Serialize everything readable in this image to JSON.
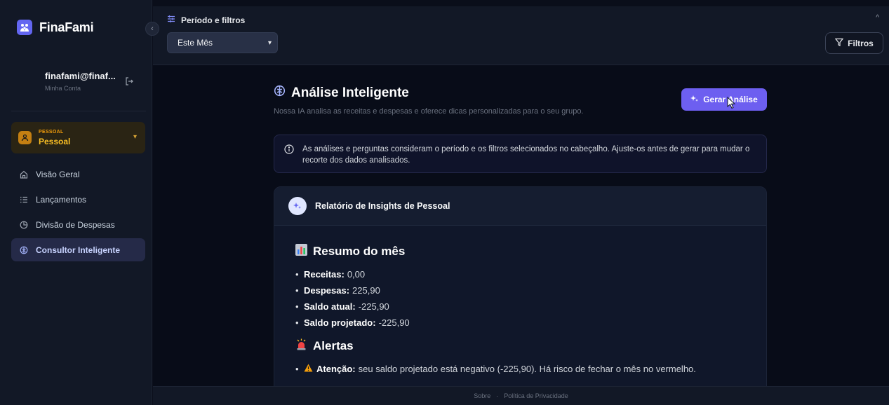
{
  "brand": {
    "name": "FinaFami"
  },
  "account": {
    "email": "finafami@finaf...",
    "label": "Minha Conta"
  },
  "group": {
    "kind": "PESSOAL",
    "name": "Pessoal"
  },
  "nav": [
    {
      "label": "Visão Geral",
      "icon": "home-icon"
    },
    {
      "label": "Lançamentos",
      "icon": "list-icon"
    },
    {
      "label": "Divisão de Despesas",
      "icon": "pie-chart-icon"
    },
    {
      "label": "Consultor Inteligente",
      "icon": "brain-icon",
      "active": true
    }
  ],
  "topbar": {
    "filters_title": "Período e filtros",
    "period_value": "Este Mês",
    "filters_button": "Filtros"
  },
  "page": {
    "title": "Análise Inteligente",
    "subtitle": "Nossa IA analisa as receitas e despesas e oferece dicas personalizadas para o seu grupo.",
    "generate_button": "Gerar Análise"
  },
  "info": {
    "text": "As análises e perguntas consideram o período e os filtros selecionados no cabeçalho. Ajuste-os antes de gerar para mudar o recorte dos dados analisados."
  },
  "report": {
    "title": "Relatório de Insights de Pessoal",
    "summary_title": "Resumo do mês",
    "summary": [
      {
        "label": "Receitas:",
        "value": "0,00"
      },
      {
        "label": "Despesas:",
        "value": "225,90"
      },
      {
        "label": "Saldo atual:",
        "value": "-225,90"
      },
      {
        "label": "Saldo projetado:",
        "value": "-225,90"
      }
    ],
    "alerts_title": "Alertas",
    "alerts": [
      {
        "label": "Atenção:",
        "value": "seu saldo projetado está negativo (-225,90). Há risco de fechar o mês no vermelho."
      }
    ]
  },
  "footer": {
    "about": "Sobre",
    "separator": "·",
    "privacy": "Política de Privacidade"
  },
  "colors": {
    "accent": "#6d5ff0",
    "group": "#fbbf24",
    "background": "#080c18"
  }
}
